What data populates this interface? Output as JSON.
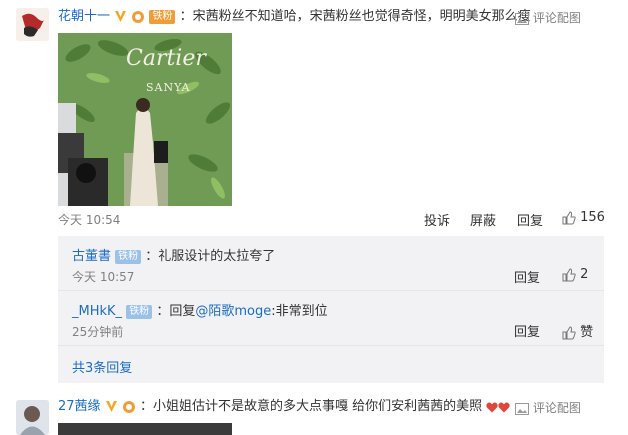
{
  "comment1": {
    "username": "花朝十一",
    "badge": "铁粉",
    "text": "：宋茜粉丝不知道哈，宋茜粉丝也觉得奇怪，明明美女那么瘦",
    "action_comment_pic": "评论配图",
    "time": "今天 10:54",
    "actions": {
      "share": "投诉",
      "block": "屏蔽",
      "reply": "回复",
      "likes": "156"
    },
    "photo": {
      "brand": "Cartier",
      "sub": "SANYA"
    }
  },
  "replies": [
    {
      "username": "古董書",
      "badge": "铁粉",
      "text": "：礼服设计的太拉夸了",
      "time": "今天 10:57",
      "reply": "回复",
      "likes": "2"
    },
    {
      "username": "_MHkK_",
      "badge": "铁粉",
      "text_prefix": "：回复",
      "mention": "@陌歌moge",
      "text_suffix": ":非常到位",
      "time": "25分钟前",
      "reply": "回复",
      "likes": "赞"
    }
  ],
  "more_replies": "共3条回复",
  "comment2": {
    "username": "27茜缘",
    "text": "：小姐姐估计不是故意的多大点事嘎 给你们安利茜茜的美照",
    "action_comment_pic": "评论配图"
  },
  "colors": {
    "link": "#eb7350",
    "blue": "#1a6cc6",
    "reply_bg": "#f2f2f5"
  }
}
